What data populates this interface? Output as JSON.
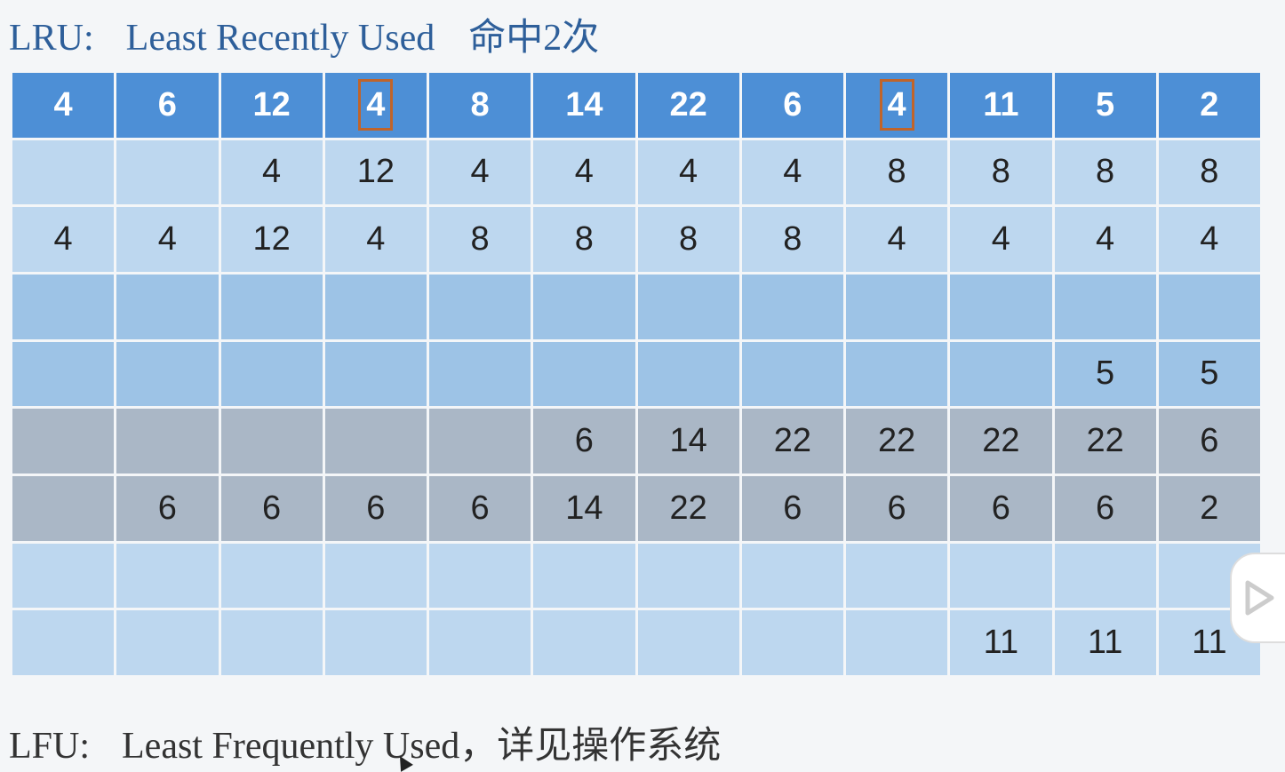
{
  "title": {
    "abbr": "LRU:",
    "full": "Least Recently Used",
    "hits": "命中2次"
  },
  "table": {
    "header": [
      "4",
      "6",
      "12",
      "4",
      "8",
      "14",
      "22",
      "6",
      "4",
      "11",
      "5",
      "2"
    ],
    "highlighted_columns": [
      3,
      8
    ],
    "rows": [
      {
        "shade": "light",
        "cells": [
          "",
          "",
          "4",
          "12",
          "4",
          "4",
          "4",
          "4",
          "8",
          "8",
          "8",
          "8"
        ]
      },
      {
        "shade": "light",
        "cells": [
          "4",
          "4",
          "12",
          "4",
          "8",
          "8",
          "8",
          "8",
          "4",
          "4",
          "4",
          "4"
        ]
      },
      {
        "shade": "mid",
        "cells": [
          "",
          "",
          "",
          "",
          "",
          "",
          "",
          "",
          "",
          "",
          "",
          ""
        ]
      },
      {
        "shade": "mid",
        "cells": [
          "",
          "",
          "",
          "",
          "",
          "",
          "",
          "",
          "",
          "",
          "5",
          "5"
        ]
      },
      {
        "shade": "gray",
        "cells": [
          "",
          "",
          "",
          "",
          "",
          "6",
          "14",
          "22",
          "22",
          "22",
          "22",
          "6"
        ]
      },
      {
        "shade": "gray",
        "cells": [
          "",
          "6",
          "6",
          "6",
          "6",
          "14",
          "22",
          "6",
          "6",
          "6",
          "6",
          "2"
        ]
      },
      {
        "shade": "light",
        "cells": [
          "",
          "",
          "",
          "",
          "",
          "",
          "",
          "",
          "",
          "",
          "",
          ""
        ]
      },
      {
        "shade": "light",
        "cells": [
          "",
          "",
          "",
          "",
          "",
          "",
          "",
          "",
          "",
          "11",
          "11",
          "11"
        ]
      }
    ]
  },
  "footer": {
    "abbr": "LFU:",
    "text": "Least Frequently Used，详见操作系统"
  },
  "icons": {
    "play": "play-icon",
    "cursor": "mouse-cursor-icon"
  },
  "colors": {
    "header_bg": "#4d8fd6",
    "highlight_border": "#c0642a",
    "light_row": "#bdd7ef",
    "mid_row": "#9dc3e6",
    "gray_row": "#aab7c6",
    "title_color": "#2e5f9a"
  }
}
